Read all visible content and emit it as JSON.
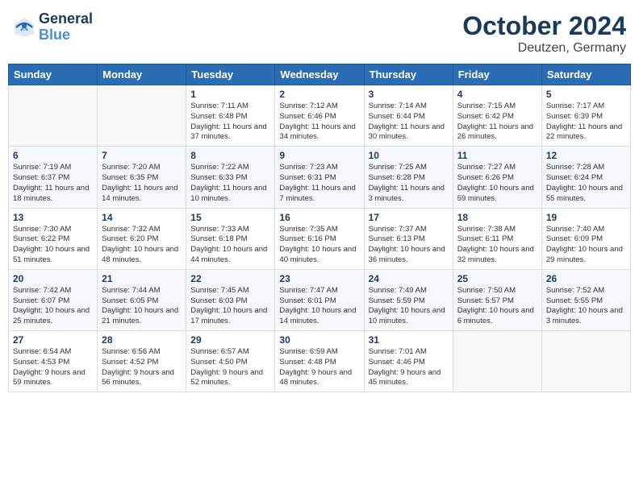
{
  "header": {
    "logo_line1": "General",
    "logo_line2": "Blue",
    "month": "October 2024",
    "location": "Deutzen, Germany"
  },
  "weekdays": [
    "Sunday",
    "Monday",
    "Tuesday",
    "Wednesday",
    "Thursday",
    "Friday",
    "Saturday"
  ],
  "weeks": [
    [
      {
        "day": "",
        "info": ""
      },
      {
        "day": "",
        "info": ""
      },
      {
        "day": "1",
        "info": "Sunrise: 7:11 AM\nSunset: 6:48 PM\nDaylight: 11 hours and 37 minutes."
      },
      {
        "day": "2",
        "info": "Sunrise: 7:12 AM\nSunset: 6:46 PM\nDaylight: 11 hours and 34 minutes."
      },
      {
        "day": "3",
        "info": "Sunrise: 7:14 AM\nSunset: 6:44 PM\nDaylight: 11 hours and 30 minutes."
      },
      {
        "day": "4",
        "info": "Sunrise: 7:15 AM\nSunset: 6:42 PM\nDaylight: 11 hours and 26 minutes."
      },
      {
        "day": "5",
        "info": "Sunrise: 7:17 AM\nSunset: 6:39 PM\nDaylight: 11 hours and 22 minutes."
      }
    ],
    [
      {
        "day": "6",
        "info": "Sunrise: 7:19 AM\nSunset: 6:37 PM\nDaylight: 11 hours and 18 minutes."
      },
      {
        "day": "7",
        "info": "Sunrise: 7:20 AM\nSunset: 6:35 PM\nDaylight: 11 hours and 14 minutes."
      },
      {
        "day": "8",
        "info": "Sunrise: 7:22 AM\nSunset: 6:33 PM\nDaylight: 11 hours and 10 minutes."
      },
      {
        "day": "9",
        "info": "Sunrise: 7:23 AM\nSunset: 6:31 PM\nDaylight: 11 hours and 7 minutes."
      },
      {
        "day": "10",
        "info": "Sunrise: 7:25 AM\nSunset: 6:28 PM\nDaylight: 11 hours and 3 minutes."
      },
      {
        "day": "11",
        "info": "Sunrise: 7:27 AM\nSunset: 6:26 PM\nDaylight: 10 hours and 59 minutes."
      },
      {
        "day": "12",
        "info": "Sunrise: 7:28 AM\nSunset: 6:24 PM\nDaylight: 10 hours and 55 minutes."
      }
    ],
    [
      {
        "day": "13",
        "info": "Sunrise: 7:30 AM\nSunset: 6:22 PM\nDaylight: 10 hours and 51 minutes."
      },
      {
        "day": "14",
        "info": "Sunrise: 7:32 AM\nSunset: 6:20 PM\nDaylight: 10 hours and 48 minutes."
      },
      {
        "day": "15",
        "info": "Sunrise: 7:33 AM\nSunset: 6:18 PM\nDaylight: 10 hours and 44 minutes."
      },
      {
        "day": "16",
        "info": "Sunrise: 7:35 AM\nSunset: 6:16 PM\nDaylight: 10 hours and 40 minutes."
      },
      {
        "day": "17",
        "info": "Sunrise: 7:37 AM\nSunset: 6:13 PM\nDaylight: 10 hours and 36 minutes."
      },
      {
        "day": "18",
        "info": "Sunrise: 7:38 AM\nSunset: 6:11 PM\nDaylight: 10 hours and 32 minutes."
      },
      {
        "day": "19",
        "info": "Sunrise: 7:40 AM\nSunset: 6:09 PM\nDaylight: 10 hours and 29 minutes."
      }
    ],
    [
      {
        "day": "20",
        "info": "Sunrise: 7:42 AM\nSunset: 6:07 PM\nDaylight: 10 hours and 25 minutes."
      },
      {
        "day": "21",
        "info": "Sunrise: 7:44 AM\nSunset: 6:05 PM\nDaylight: 10 hours and 21 minutes."
      },
      {
        "day": "22",
        "info": "Sunrise: 7:45 AM\nSunset: 6:03 PM\nDaylight: 10 hours and 17 minutes."
      },
      {
        "day": "23",
        "info": "Sunrise: 7:47 AM\nSunset: 6:01 PM\nDaylight: 10 hours and 14 minutes."
      },
      {
        "day": "24",
        "info": "Sunrise: 7:49 AM\nSunset: 5:59 PM\nDaylight: 10 hours and 10 minutes."
      },
      {
        "day": "25",
        "info": "Sunrise: 7:50 AM\nSunset: 5:57 PM\nDaylight: 10 hours and 6 minutes."
      },
      {
        "day": "26",
        "info": "Sunrise: 7:52 AM\nSunset: 5:55 PM\nDaylight: 10 hours and 3 minutes."
      }
    ],
    [
      {
        "day": "27",
        "info": "Sunrise: 6:54 AM\nSunset: 4:53 PM\nDaylight: 9 hours and 59 minutes."
      },
      {
        "day": "28",
        "info": "Sunrise: 6:56 AM\nSunset: 4:52 PM\nDaylight: 9 hours and 56 minutes."
      },
      {
        "day": "29",
        "info": "Sunrise: 6:57 AM\nSunset: 4:50 PM\nDaylight: 9 hours and 52 minutes."
      },
      {
        "day": "30",
        "info": "Sunrise: 6:59 AM\nSunset: 4:48 PM\nDaylight: 9 hours and 48 minutes."
      },
      {
        "day": "31",
        "info": "Sunrise: 7:01 AM\nSunset: 4:46 PM\nDaylight: 9 hours and 45 minutes."
      },
      {
        "day": "",
        "info": ""
      },
      {
        "day": "",
        "info": ""
      }
    ]
  ]
}
